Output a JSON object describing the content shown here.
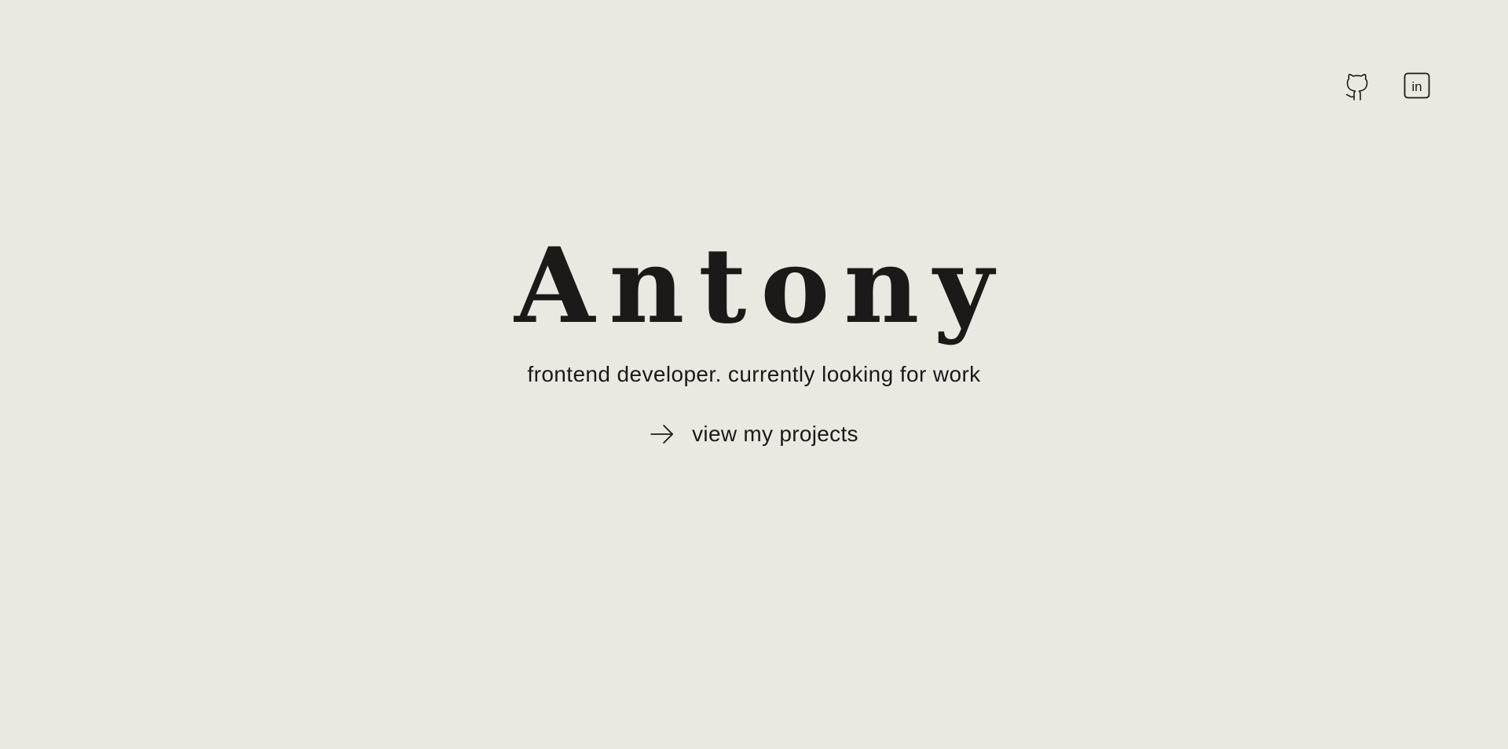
{
  "hero": {
    "name": "Antony",
    "tagline": "frontend developer. currently looking for work",
    "cta_label": "view my projects",
    "cta_icon": "arrow-right-icon"
  },
  "social": [
    {
      "name": "GitHub",
      "icon": "github-icon"
    },
    {
      "name": "LinkedIn",
      "icon": "linkedin-icon",
      "glyph": "in"
    }
  ],
  "colors": {
    "background": "#ebe8e1",
    "text": "#1c1a19"
  }
}
